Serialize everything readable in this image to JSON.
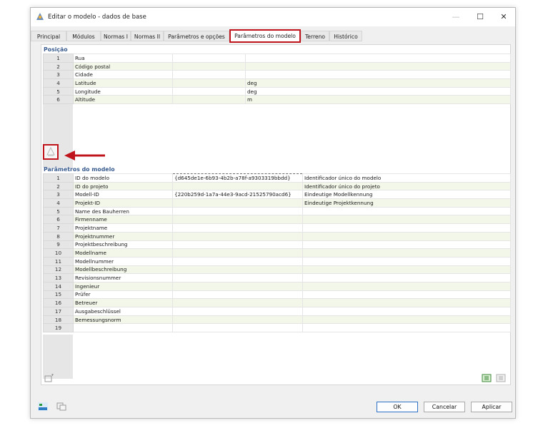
{
  "window": {
    "title": "Editar o modelo - dados de base"
  },
  "tabs": [
    {
      "label": "Principal"
    },
    {
      "label": "Módulos"
    },
    {
      "label": "Normas I"
    },
    {
      "label": "Normas II"
    },
    {
      "label": "Parâmetros e opções"
    },
    {
      "label": "Parâmetros do modelo"
    },
    {
      "label": "Terreno"
    },
    {
      "label": "Histórico"
    }
  ],
  "active_tab": "Parâmetros do modelo",
  "position": {
    "title": "Posição",
    "rows": [
      {
        "n": "1",
        "name": "Rua",
        "unit": ""
      },
      {
        "n": "2",
        "name": "Código postal",
        "unit": ""
      },
      {
        "n": "3",
        "name": "Cidade",
        "unit": ""
      },
      {
        "n": "4",
        "name": "Latitude",
        "unit": "deg"
      },
      {
        "n": "5",
        "name": "Longitude",
        "unit": "deg"
      },
      {
        "n": "6",
        "name": "Altitude",
        "unit": "m"
      }
    ]
  },
  "model_params": {
    "title": "Parâmetros do modelo",
    "rows": [
      {
        "n": "1",
        "name": "ID do modelo",
        "value": "{d645de1e-6b93-4b2b-a78f-a9303319bbdd}",
        "desc": "Identificador único do modelo"
      },
      {
        "n": "2",
        "name": "ID do projeto",
        "value": "",
        "desc": "Identificador único do projeto"
      },
      {
        "n": "3",
        "name": "Modell-ID",
        "value": "{220b259d-1a7a-44e3-9acd-21525790acd6}",
        "desc": "Eindeutige Modellkennung"
      },
      {
        "n": "4",
        "name": "Projekt-ID",
        "value": "",
        "desc": "Eindeutige Projektkennung"
      },
      {
        "n": "5",
        "name": "Name des Bauherren",
        "value": "",
        "desc": ""
      },
      {
        "n": "6",
        "name": "Firmenname",
        "value": "",
        "desc": ""
      },
      {
        "n": "7",
        "name": "Projektname",
        "value": "",
        "desc": ""
      },
      {
        "n": "8",
        "name": "Projektnummer",
        "value": "",
        "desc": ""
      },
      {
        "n": "9",
        "name": "Projektbeschreibung",
        "value": "",
        "desc": ""
      },
      {
        "n": "10",
        "name": "Modellname",
        "value": "",
        "desc": ""
      },
      {
        "n": "11",
        "name": "Modellnummer",
        "value": "",
        "desc": ""
      },
      {
        "n": "12",
        "name": "Modellbeschreibung",
        "value": "",
        "desc": ""
      },
      {
        "n": "13",
        "name": "Revisionsnummer",
        "value": "",
        "desc": ""
      },
      {
        "n": "14",
        "name": "Ingenieur",
        "value": "",
        "desc": ""
      },
      {
        "n": "15",
        "name": "Prüfer",
        "value": "",
        "desc": ""
      },
      {
        "n": "16",
        "name": "Betreuer",
        "value": "",
        "desc": ""
      },
      {
        "n": "17",
        "name": "Ausgabeschlüssel",
        "value": "",
        "desc": ""
      },
      {
        "n": "18",
        "name": "Bemessungsnorm",
        "value": "",
        "desc": ""
      },
      {
        "n": "19",
        "name": "",
        "value": "",
        "desc": ""
      }
    ]
  },
  "buttons": {
    "ok": "OK",
    "cancel": "Cancelar",
    "apply": "Aplicar"
  },
  "colors": {
    "accent_red": "#c0141c",
    "section_blue": "#3b5d8f",
    "row_alt": "#f3f7e9"
  },
  "icons": [
    "app-icon",
    "minimize-icon",
    "maximize-icon",
    "close-icon",
    "position-import-icon",
    "add-param-icon",
    "export-icon",
    "import-icon",
    "units-icon",
    "copy-icon"
  ]
}
